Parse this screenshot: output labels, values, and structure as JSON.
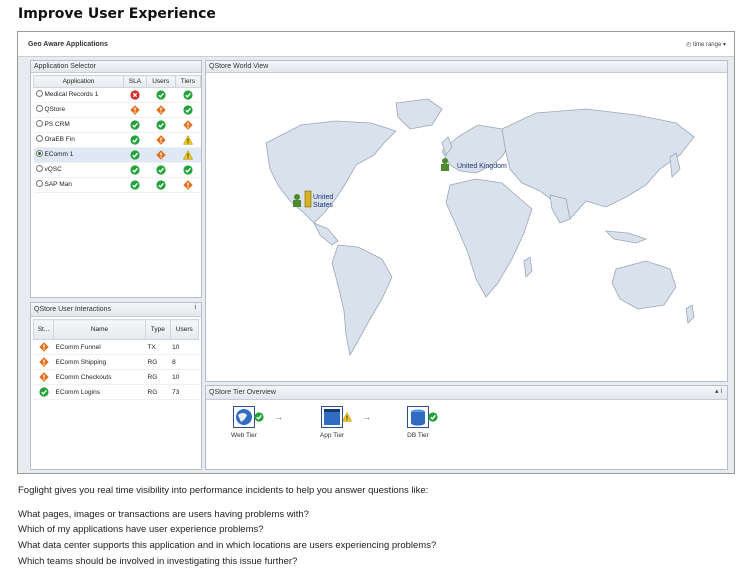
{
  "page_title": "Improve User Experience",
  "app": {
    "title": "Geo Aware Applications",
    "time_range": "◴ time range ▾"
  },
  "app_selector": {
    "title": "Application Selector",
    "headers": {
      "application": "Application",
      "sla": "SLA",
      "users": "Users",
      "tiers": "Tiers"
    },
    "rows": [
      {
        "name": "Medical Records 1",
        "selected": false,
        "sla": "error",
        "users": "ok",
        "tiers": "ok"
      },
      {
        "name": "QStore",
        "selected": false,
        "sla": "critical",
        "users": "critical",
        "tiers": "ok"
      },
      {
        "name": "PS CRM",
        "selected": false,
        "sla": "ok",
        "users": "ok",
        "tiers": "critical"
      },
      {
        "name": "OraEB Fin",
        "selected": false,
        "sla": "ok",
        "users": "critical",
        "tiers": "warning"
      },
      {
        "name": "EComm 1",
        "selected": true,
        "sla": "ok",
        "users": "critical",
        "tiers": "warning"
      },
      {
        "name": "vQSC",
        "selected": false,
        "sla": "ok",
        "users": "ok",
        "tiers": "ok"
      },
      {
        "name": "SAP Man",
        "selected": false,
        "sla": "ok",
        "users": "ok",
        "tiers": "critical"
      }
    ]
  },
  "interactions": {
    "title": "QStore User Interactions",
    "info": "i",
    "headers": {
      "status": "St...",
      "name": "Name",
      "type": "Type",
      "users": "Users"
    },
    "rows": [
      {
        "status": "critical",
        "name": "EComm Funnel",
        "type": "TX",
        "users": "10"
      },
      {
        "status": "critical",
        "name": "EComm Shipping",
        "type": "RG",
        "users": "8"
      },
      {
        "status": "critical",
        "name": "EComm Checkouts",
        "type": "RG",
        "users": "10"
      },
      {
        "status": "ok",
        "name": "EComm Logins",
        "type": "RG",
        "users": "73"
      }
    ]
  },
  "world_view": {
    "title": "QStore World View",
    "locations": [
      {
        "label_1": "United",
        "label_2": "States"
      },
      {
        "label_1": "United Kingdom"
      }
    ]
  },
  "tier_overview": {
    "title": "QStore Tier Overview",
    "controls": "▴ i",
    "tiers": [
      {
        "label": "Web Tier",
        "status": "ok"
      },
      {
        "label": "App Tier",
        "status": "warning"
      },
      {
        "label": "DB Tier",
        "status": "ok"
      }
    ]
  },
  "body_text": {
    "intro": "Foglight gives you real time visibility into performance incidents to help you answer questions like:",
    "questions": [
      "What pages, images or transactions are users having problems with?",
      "Which of my applications have user experience problems?",
      "What data center supports this application and in which locations are users experiencing problems?",
      "Which teams should be involved in investigating this issue further?"
    ]
  },
  "colors": {
    "ok": "#22a33a",
    "critical": "#e0701e",
    "warning": "#f3c614",
    "error": "#d62b25",
    "map_land": "#d9e1ec",
    "map_sea": "#ffffff"
  }
}
